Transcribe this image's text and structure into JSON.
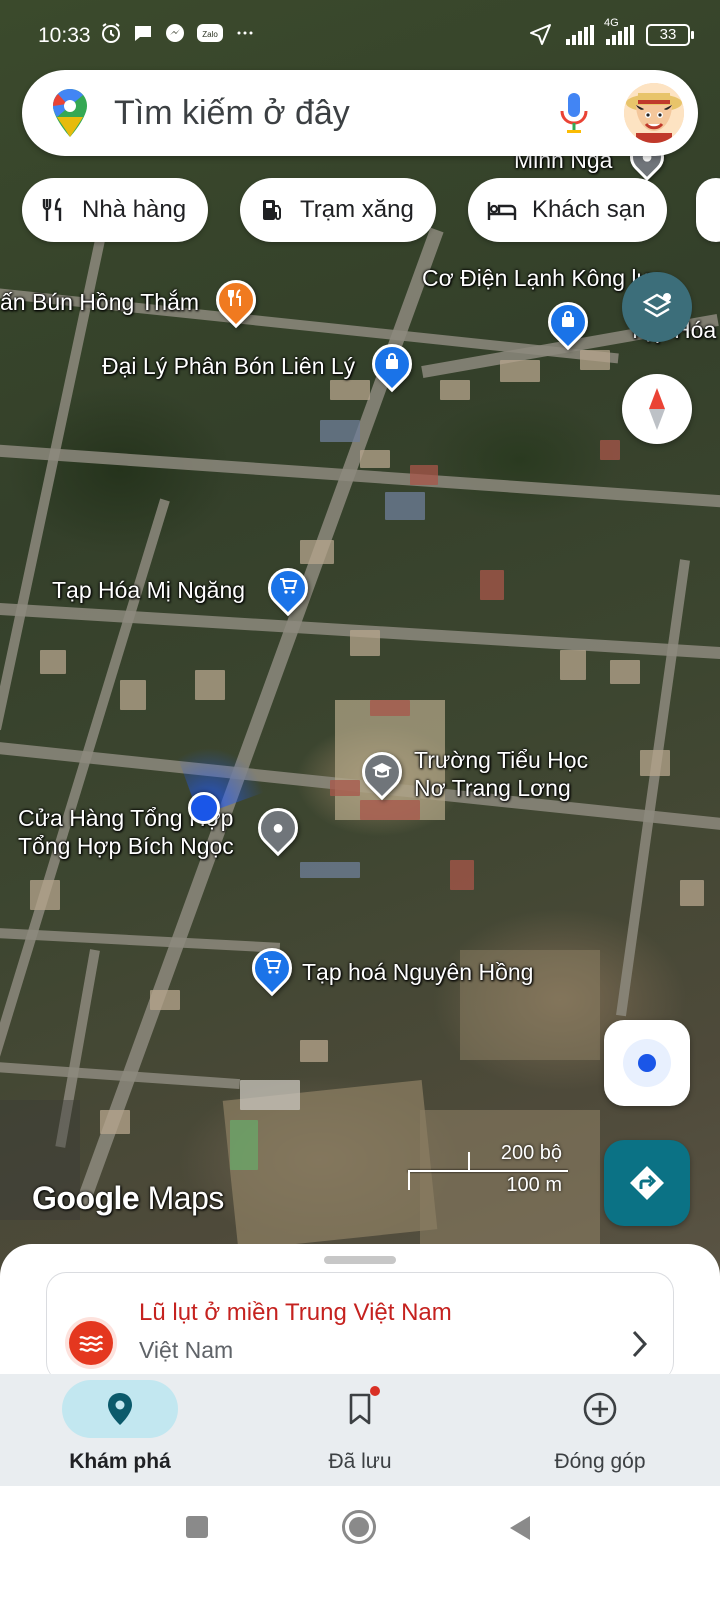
{
  "status_bar": {
    "time": "10:33",
    "network": "4G",
    "battery": "33"
  },
  "search": {
    "placeholder": "Tìm kiếm ở đây"
  },
  "chips": [
    {
      "label": "Nhà hàng",
      "icon": "restaurant-icon"
    },
    {
      "label": "Trạm xăng",
      "icon": "gas-station-icon"
    },
    {
      "label": "Khách sạn",
      "icon": "hotel-icon"
    }
  ],
  "map": {
    "places": [
      {
        "name": "Minh Nga",
        "icon": "place-icon"
      },
      {
        "name": "Cơ Điện Lạnh Kông lực",
        "icon": "place-icon"
      },
      {
        "name": "ấn Bún Hồng Thắm",
        "icon": "restaurant-icon"
      },
      {
        "name": "Tạp Hóa T",
        "icon": "shopping-bag-icon"
      },
      {
        "name": "Đại Lý Phân Bón Liên Lý",
        "icon": "shopping-bag-icon"
      },
      {
        "name": "Tạp Hóa Mị Ngăng",
        "icon": "cart-icon"
      },
      {
        "name": "Trường Tiểu Học Nơ Trang Lơng",
        "icon": "school-icon"
      },
      {
        "name": "Cửa Hàng Tổng Hợp Tổng Hợp Bích Ngọc",
        "icon": "place-icon"
      },
      {
        "name": "Tạp hoá Nguyên Hồng",
        "icon": "cart-icon"
      }
    ],
    "brand": "Google Maps",
    "scale_imperial": "200 bộ",
    "scale_metric": "100 m"
  },
  "alert_card": {
    "title": "Lũ lụt ở miền Trung Việt Nam",
    "subtitle": "Việt Nam"
  },
  "nav": [
    {
      "label": "Khám phá",
      "active": true
    },
    {
      "label": "Đã lưu",
      "active": false
    },
    {
      "label": "Đóng góp",
      "active": false
    }
  ],
  "colors": {
    "accent": "#1a73e8",
    "teal_fab": "#0b7285",
    "alert_red": "#c5221f",
    "nav_active": "#c2e7f0"
  }
}
